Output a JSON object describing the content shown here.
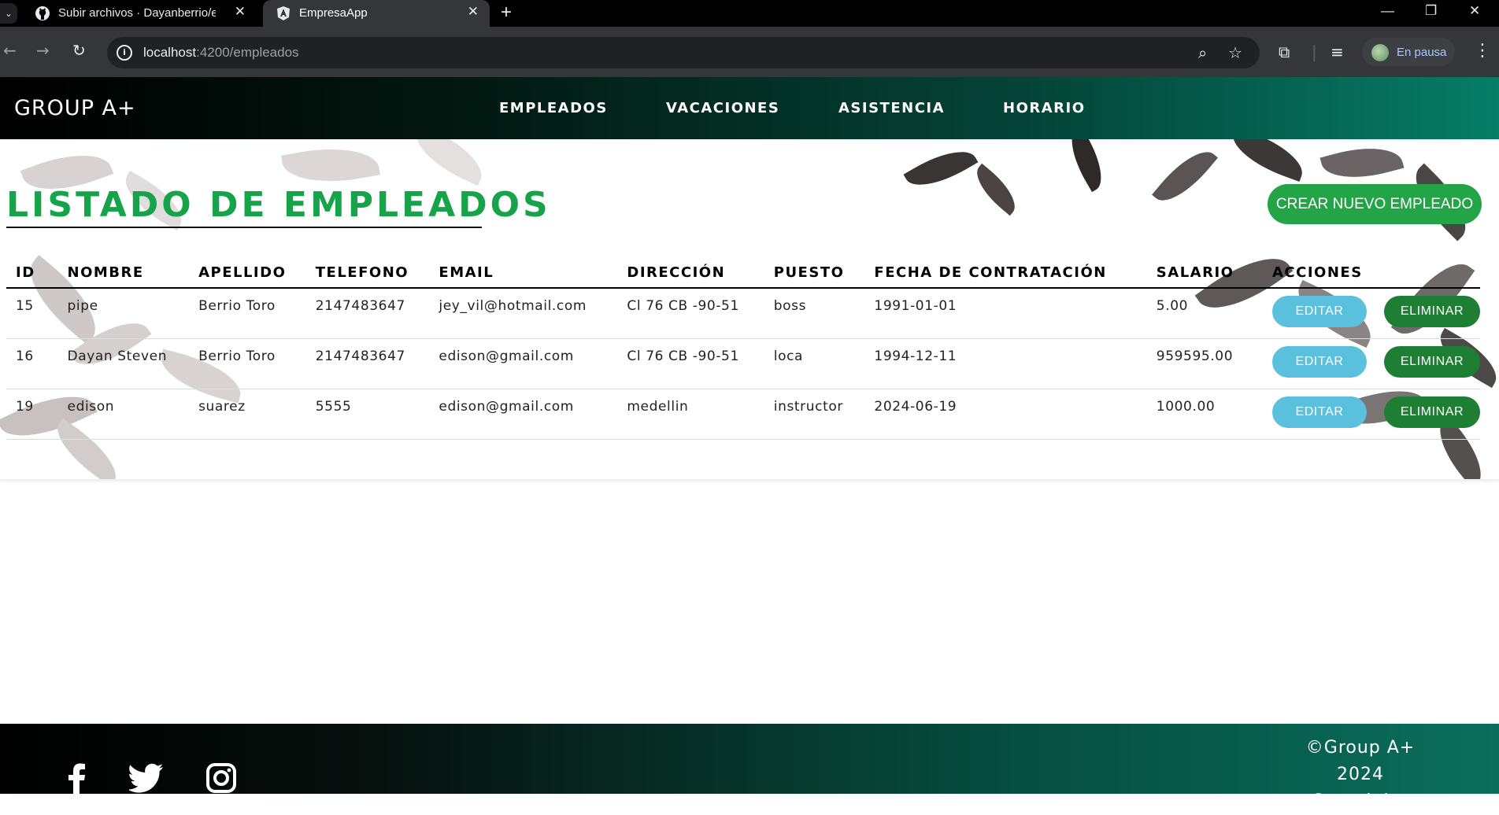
{
  "browser": {
    "tabs": [
      {
        "label": "Subir archivos · Dayanberrio/em",
        "active": false
      },
      {
        "label": "EmpresaApp",
        "active": true
      }
    ],
    "url_host": "localhost",
    "url_path": ":4200/empleados",
    "profile_label": "En pausa"
  },
  "navbar": {
    "brand": "GROUP A+",
    "links": [
      "EMPLEADOS",
      "VACACIONES",
      "ASISTENCIA",
      "HORARIO"
    ]
  },
  "page": {
    "title": "LISTADO DE EMPLEADOS",
    "create_button": "CREAR NUEVO EMPLEADO"
  },
  "table": {
    "headers": [
      "ID",
      "NOMBRE",
      "APELLIDO",
      "TELEFONO",
      "EMAIL",
      "DIRECCIÓN",
      "PUESTO",
      "FECHA DE CONTRATACIÓN",
      "SALARIO",
      "ACCIONES"
    ],
    "rows": [
      [
        "15",
        "pipe",
        "Berrio Toro",
        "2147483647",
        "jey_vil@hotmail.com",
        "Cl 76 CB -90-51",
        "boss",
        "1991-01-01",
        "5.00"
      ],
      [
        "16",
        "Dayan Steven",
        "Berrio Toro",
        "2147483647",
        "edison@gmail.com",
        "Cl 76 CB -90-51",
        "loca",
        "1994-12-11",
        "959595.00"
      ],
      [
        "19",
        "edison",
        "suarez",
        "5555",
        "edison@gmail.com",
        "medellin",
        "instructor",
        "2024-06-19",
        "1000.00"
      ]
    ],
    "edit_label": "EDITAR",
    "delete_label": "ELIMINAR"
  },
  "footer": {
    "copyright": "©Group A+ 2024",
    "copyright_label": "Copyright:",
    "social_icons": [
      "facebook-icon",
      "twitter-icon",
      "instagram-icon"
    ]
  },
  "colors": {
    "title_green": "#16a34a",
    "create_button": "#22a447",
    "edit_button": "#5bc0de",
    "delete_button": "#1e7e34"
  }
}
